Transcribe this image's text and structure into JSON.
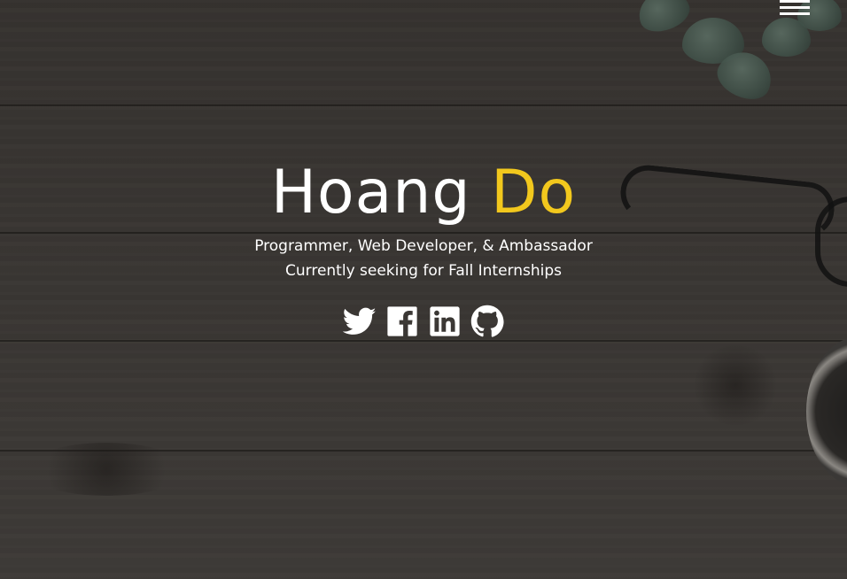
{
  "header": {
    "menu_icon": "hamburger-menu-icon"
  },
  "hero": {
    "first_name": "Hoang",
    "last_name": "Do",
    "tagline_line1": "Programmer, Web Developer, & Ambassador",
    "tagline_line2": "Currently seeking for Fall Internships",
    "accent_color": "#f2c81d",
    "text_color": "#ffffff"
  },
  "socials": [
    {
      "icon": "twitter-icon"
    },
    {
      "icon": "facebook-icon"
    },
    {
      "icon": "linkedin-icon"
    },
    {
      "icon": "github-icon"
    }
  ]
}
